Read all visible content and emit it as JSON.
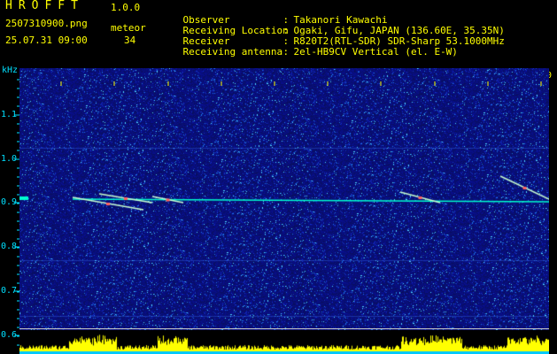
{
  "header": {
    "app_name": "HROFFT",
    "version": "1.0.0",
    "filename": "2507310900.png",
    "meteor_label": "meteor",
    "datetime": "25.07.31 09:00",
    "meteor_count": "34"
  },
  "info": [
    {
      "key": "Observer",
      "value": "Takanori Kawachi"
    },
    {
      "key": "Receiving Location",
      "value": "Ogaki, Gifu, JAPAN (136.60E, 35.35N)"
    },
    {
      "key": "Receiver",
      "value": "R820T2(RTL-SDR) SDR-Sharp 53.1000MHz"
    },
    {
      "key": "Receiving antenna",
      "value": "2el-HB9CV Vertical (el. E-W)"
    }
  ],
  "axis": {
    "y_unit": "kHz",
    "y_labels": [
      "1.1",
      "1.0",
      "0.9",
      "0.8",
      "0.7",
      "0.6"
    ],
    "x_labels": [
      "0901",
      "0902",
      "0903",
      "0904",
      "0905",
      "0906",
      "0907",
      "0908",
      "0909",
      "0910"
    ]
  },
  "colors": {
    "text": "#ffff00",
    "axis": "#00e0ff",
    "background": "#000000",
    "noise": "#0a1a8c",
    "carrier": "#00ffd0",
    "activity": "#ffff00"
  }
}
